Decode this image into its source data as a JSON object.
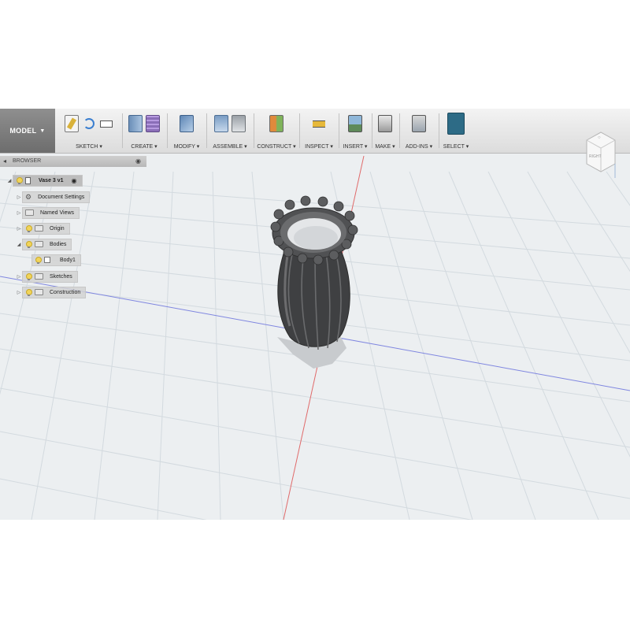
{
  "toolbar": {
    "workspace": "MODEL",
    "groups": [
      {
        "label": "SKETCH"
      },
      {
        "label": "CREATE"
      },
      {
        "label": "MODIFY"
      },
      {
        "label": "ASSEMBLE"
      },
      {
        "label": "CONSTRUCT"
      },
      {
        "label": "INSPECT"
      },
      {
        "label": "INSERT"
      },
      {
        "label": "MAKE"
      },
      {
        "label": "ADD-INS"
      },
      {
        "label": "SELECT"
      }
    ]
  },
  "browser": {
    "title": "BROWSER",
    "root": "Vase 3 v1",
    "items": [
      {
        "label": "Document Settings",
        "icon": "gear-icon"
      },
      {
        "label": "Named Views",
        "icon": "folder-icon"
      },
      {
        "label": "Origin",
        "icon": "folder-icon"
      },
      {
        "label": "Bodies",
        "icon": "folder-icon"
      },
      {
        "label": "Body1",
        "icon": "body-icon"
      },
      {
        "label": "Sketches",
        "icon": "folder-icon"
      },
      {
        "label": "Construction",
        "icon": "folder-icon"
      }
    ]
  },
  "viewcube": {
    "face": "RIGHT"
  },
  "colors": {
    "viewport": "#eceff1",
    "grid": "#cfd6db",
    "x_axis": "#e06a6a",
    "y_axis": "#7f86e0",
    "vase": "#4a4a4a",
    "select_accent": "#2d6b86"
  }
}
